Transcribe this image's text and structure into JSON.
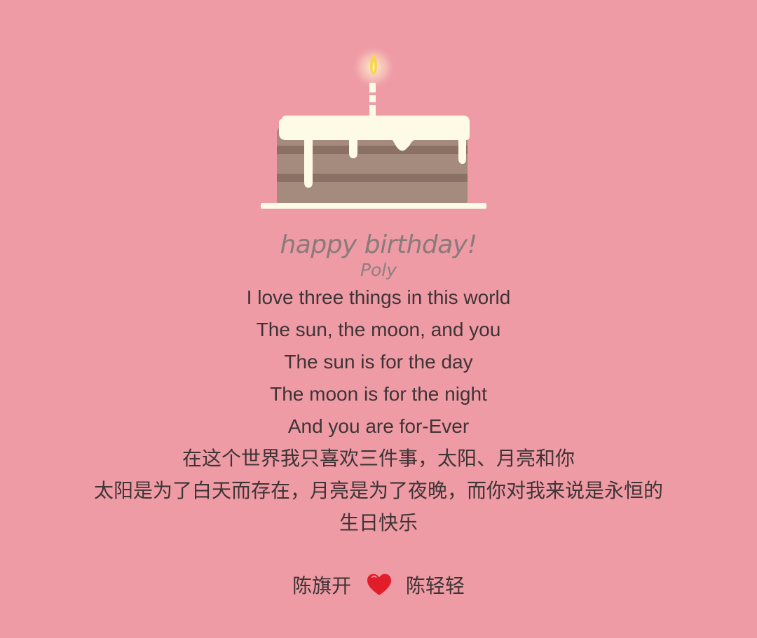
{
  "title": "happy birthday!",
  "subtitle": "Poly",
  "poem": {
    "lines": [
      "I love three things in this world",
      "The sun, the moon, and you",
      "The sun is for the day",
      "The moon is for the night",
      "And you are for-Ever",
      "在这个世界我只喜欢三件事，太阳、月亮和你",
      "太阳是为了白天而存在，月亮是为了夜晚，而你对我来说是永恒的",
      "生日快乐"
    ]
  },
  "signature": {
    "left": "陈旗开",
    "right": "陈轻轻",
    "icon": "heart-icon"
  },
  "colors": {
    "background": "#ee9ba6",
    "text": "#3f3435",
    "heading": "#8a7a79",
    "icing": "#fdfbe6",
    "cake": "#a58a7e",
    "cake_layer": "#8b7065",
    "heart": "#e11d2a"
  }
}
